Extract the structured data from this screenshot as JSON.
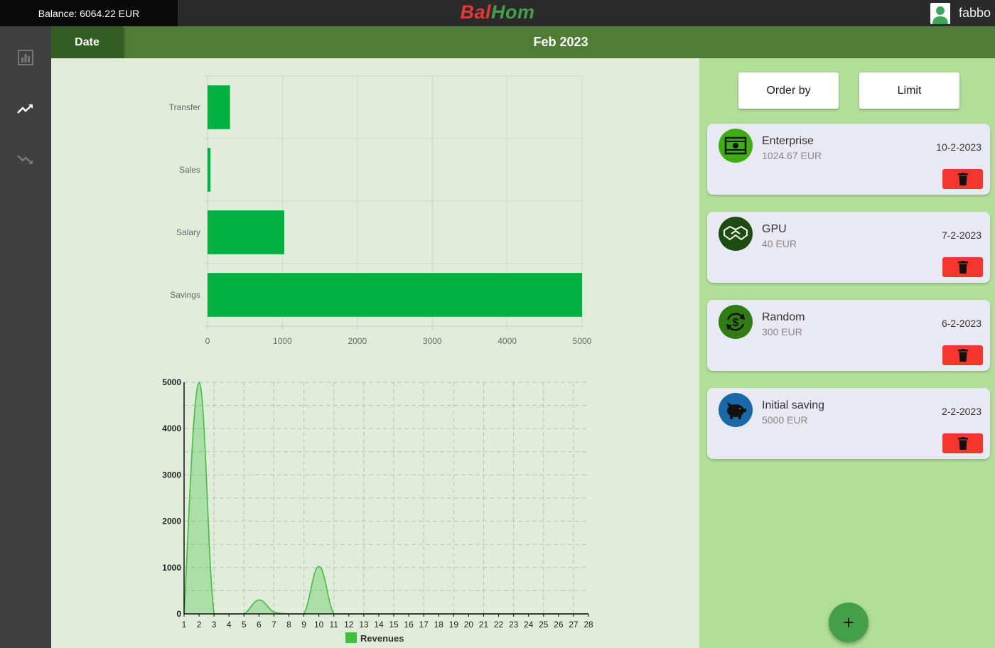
{
  "topbar": {
    "balance": "Balance: 6064.22 EUR",
    "logo_part1": "Bal",
    "logo_part2": "Hom",
    "username": "fabbo"
  },
  "sidebar": {
    "items": [
      {
        "icon": "bar-chart-icon",
        "active": false
      },
      {
        "icon": "trending-up-icon",
        "active": true
      },
      {
        "icon": "trending-down-icon",
        "active": false
      }
    ]
  },
  "header": {
    "date_tab": "Date",
    "month": "Feb 2023"
  },
  "controls": {
    "order_by": "Order by",
    "limit": "Limit"
  },
  "transactions": [
    {
      "name": "Enterprise",
      "amount": "1024.67 EUR",
      "date": "10-2-2023",
      "icon": "cash-icon",
      "icon_color": "#3dae0f"
    },
    {
      "name": "GPU",
      "amount": "40 EUR",
      "date": "7-2-2023",
      "icon": "handshake-icon",
      "icon_color": "#1d4d0e"
    },
    {
      "name": "Random",
      "amount": "300 EUR",
      "date": "6-2-2023",
      "icon": "dollar-cycle-icon",
      "icon_color": "#2f7d12"
    },
    {
      "name": "Initial saving",
      "amount": "5000 EUR",
      "date": "2-2-2023",
      "icon": "piggy-bank-icon",
      "icon_color": "#1769aa"
    }
  ],
  "fab": {
    "label": "+"
  },
  "chart_data": [
    {
      "type": "bar",
      "orientation": "horizontal",
      "categories": [
        "Transfer",
        "Sales",
        "Salary",
        "Savings"
      ],
      "values": [
        300,
        40,
        1024.67,
        5000
      ],
      "xlim": [
        0,
        5000
      ],
      "xticks": [
        0,
        1000,
        2000,
        3000,
        4000,
        5000
      ],
      "color": "#00b140",
      "grid": true
    },
    {
      "type": "area",
      "series": [
        {
          "name": "Revenues",
          "x": [
            1,
            2,
            3,
            4,
            5,
            6,
            7,
            8,
            9,
            10,
            11,
            12,
            13,
            14,
            15,
            16,
            17,
            18,
            19,
            20,
            21,
            22,
            23,
            24,
            25,
            26,
            27,
            28
          ],
          "values": [
            0,
            5000,
            0,
            0,
            0,
            300,
            40,
            0,
            0,
            1024.67,
            0,
            0,
            0,
            0,
            0,
            0,
            0,
            0,
            0,
            0,
            0,
            0,
            0,
            0,
            0,
            0,
            0,
            0
          ]
        }
      ],
      "ylim": [
        0,
        5000
      ],
      "yticks": [
        0,
        1000,
        2000,
        3000,
        4000,
        5000
      ],
      "xticks": [
        1,
        2,
        3,
        4,
        5,
        6,
        7,
        8,
        9,
        10,
        11,
        12,
        13,
        14,
        15,
        16,
        17,
        18,
        19,
        20,
        21,
        22,
        23,
        24,
        25,
        26,
        27,
        28
      ],
      "color": "#3ec03e",
      "grid": "dashed",
      "legend": "bottom"
    }
  ]
}
